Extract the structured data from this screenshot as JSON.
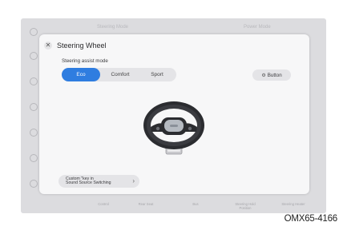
{
  "background": {
    "header_left": "Steering Mode",
    "header_right": "Power Mode",
    "bottom_labels": [
      "Control",
      "Rear Seat",
      "Bus",
      "Steering Hold Position",
      "Steering Heater"
    ]
  },
  "dialog": {
    "close_icon": "close-icon",
    "title": "Steering Wheel",
    "section_label": "Steering assist mode",
    "modes": [
      {
        "label": "Eco",
        "active": true
      },
      {
        "label": "Comfort",
        "active": false
      },
      {
        "label": "Sport",
        "active": false
      }
    ],
    "button_icon": "settings-icon",
    "button_label": "Button",
    "custom_key": {
      "line1": "Custom \"key in",
      "line2": "Sound Source Switching",
      "chevron": "›"
    }
  },
  "colors": {
    "accent": "#2f7de0",
    "panel": "#f7f7f8",
    "screen_bg": "#dcdcdf"
  },
  "caption": "OMX65-4166"
}
